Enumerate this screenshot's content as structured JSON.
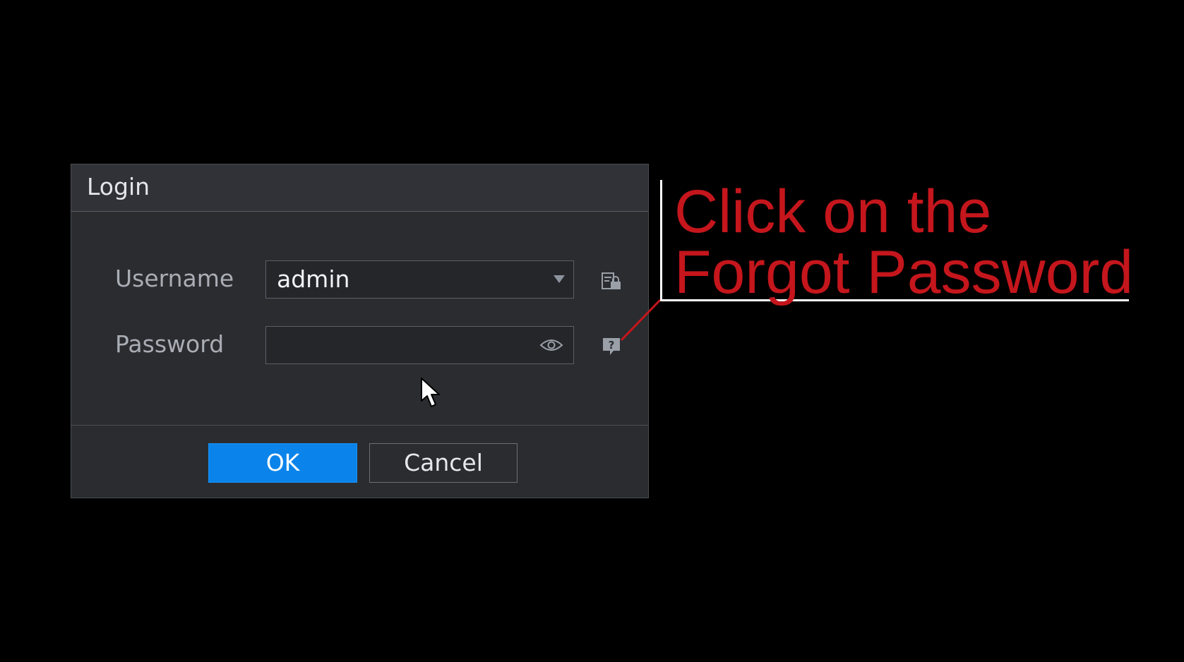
{
  "dialog": {
    "title": "Login",
    "username_label": "Username",
    "username_value": "admin",
    "password_label": "Password",
    "password_value": "",
    "ok_label": "OK",
    "cancel_label": "Cancel"
  },
  "icons": {
    "username_dropdown": "chevron-down-icon",
    "pattern_login": "pattern-lock-icon",
    "show_password": "eye-icon",
    "forgot_password": "help-icon",
    "cursor": "mouse-cursor"
  },
  "callout": {
    "line1": "Click on the",
    "line2": "Forgot Password"
  },
  "colors": {
    "accent": "#0a84ea",
    "callout": "#c4161c",
    "dialog_bg": "#2a2c30"
  }
}
